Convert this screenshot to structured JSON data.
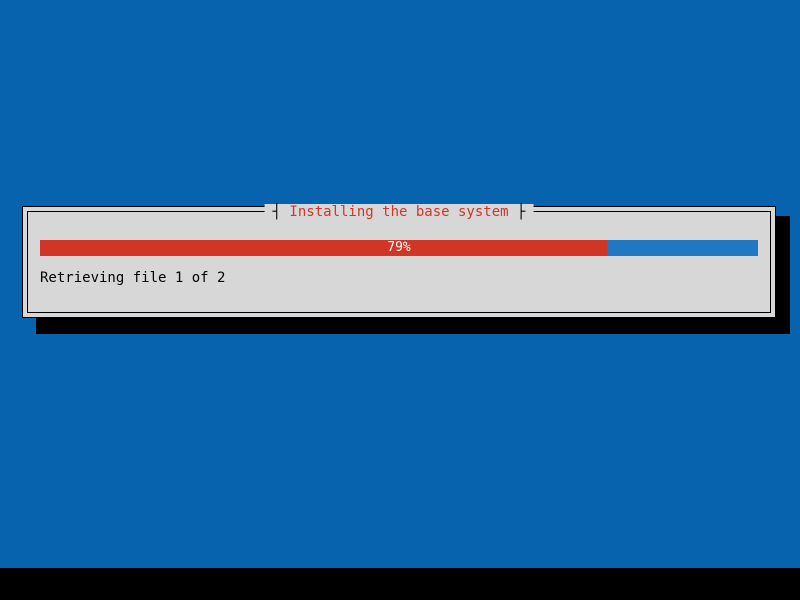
{
  "dialog": {
    "title": "Installing the base system",
    "progress_percent": 79,
    "progress_label": "79%",
    "status": "Retrieving file 1 of 2"
  }
}
